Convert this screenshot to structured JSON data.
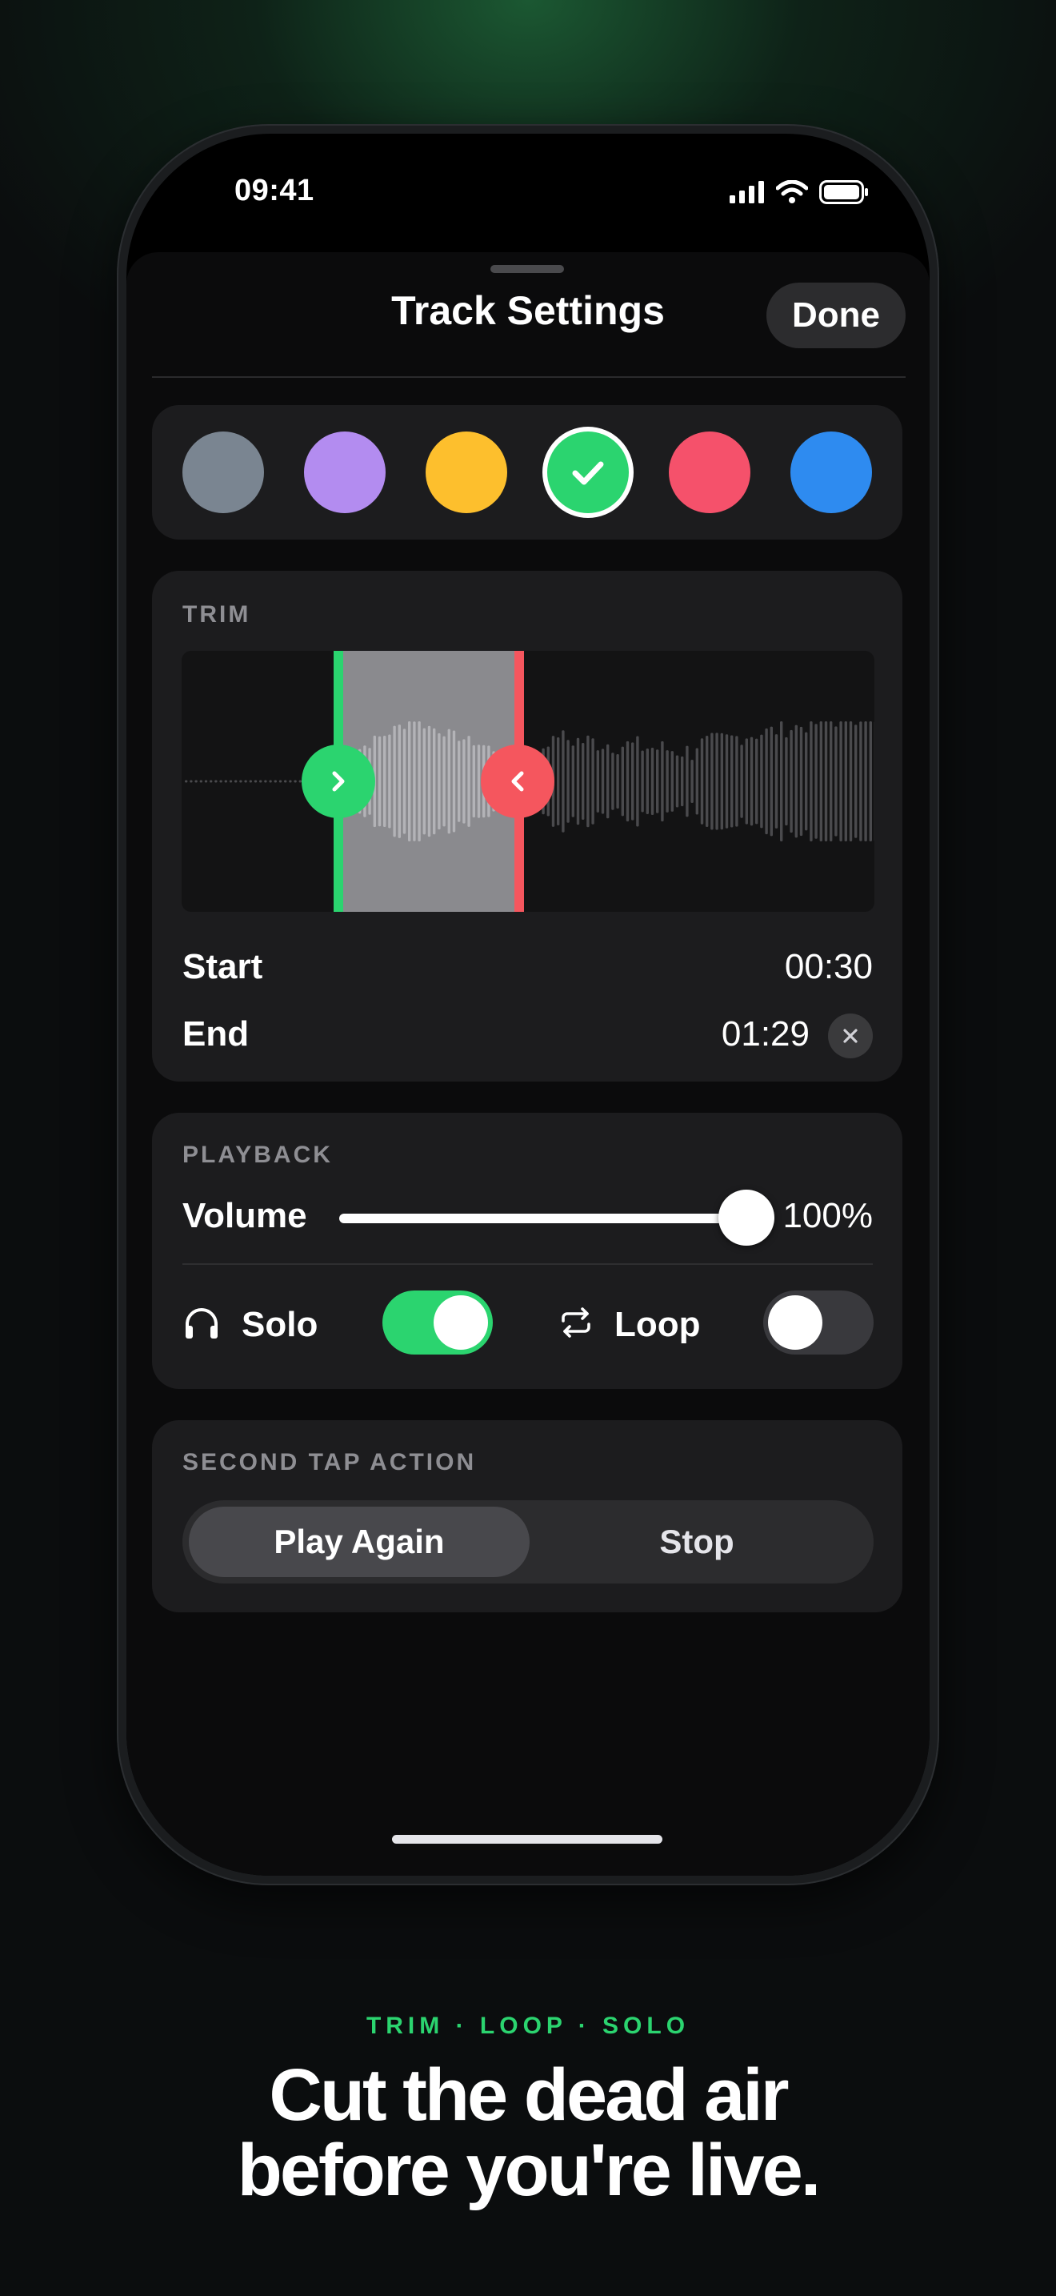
{
  "status_bar": {
    "time": "09:41"
  },
  "sheet": {
    "title": "Track Settings",
    "done_label": "Done"
  },
  "swatches": [
    {
      "name": "slate",
      "color": "#7a8591",
      "selected": false
    },
    {
      "name": "purple",
      "color": "#b38cf0",
      "selected": false
    },
    {
      "name": "yellow",
      "color": "#fdbf2d",
      "selected": false
    },
    {
      "name": "green",
      "color": "#2bd46f",
      "selected": true
    },
    {
      "name": "red",
      "color": "#f5516b",
      "selected": false
    },
    {
      "name": "blue",
      "color": "#2e8bf0",
      "selected": false
    }
  ],
  "trim": {
    "label": "TRIM",
    "start_label": "Start",
    "start_value": "00:30",
    "end_label": "End",
    "end_value": "01:29",
    "start_handle_color": "#2bd46f",
    "end_handle_color": "#f5565e"
  },
  "playback": {
    "label": "PLAYBACK",
    "volume_label": "Volume",
    "volume_value": "100%",
    "volume_level": 1.0,
    "solo_label": "Solo",
    "solo_on": true,
    "loop_label": "Loop",
    "loop_on": false
  },
  "second_tap": {
    "label": "SECOND TAP ACTION",
    "options": [
      "Play Again",
      "Stop"
    ],
    "selected": "Play Again"
  },
  "marketing": {
    "eyebrow": "TRIM · LOOP · SOLO",
    "headline_line1": "Cut the dead air",
    "headline_line2": "before you're live."
  },
  "colors": {
    "accent": "#2bd46f",
    "danger": "#f5565e",
    "card": "#1c1c1e"
  }
}
